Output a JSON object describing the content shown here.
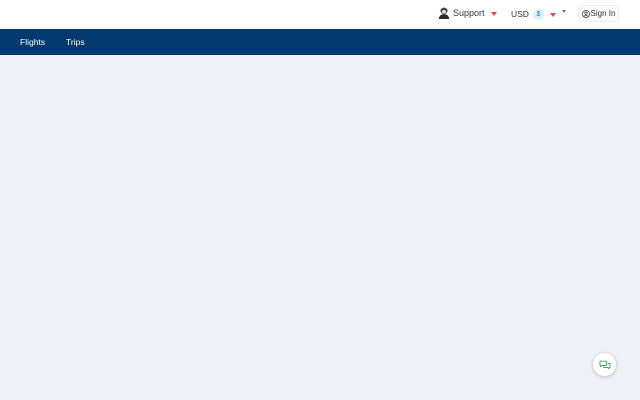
{
  "header": {
    "support_label": "Support",
    "currency_code": "USD",
    "currency_symbol": "$",
    "sign_in_label": "Sign In"
  },
  "nav": {
    "items": [
      {
        "label": "Flights"
      },
      {
        "label": "Trips"
      }
    ]
  },
  "colors": {
    "nav_bg": "#023a6f",
    "page_bg": "#eef2f8",
    "accent_red": "#e0473f",
    "chat_green": "#3aa35a"
  },
  "icons": {
    "support": "support-agent-icon",
    "currency_caret": "chevron-down-icon",
    "sign_in": "user-icon",
    "chat": "chat-bubbles-icon"
  }
}
